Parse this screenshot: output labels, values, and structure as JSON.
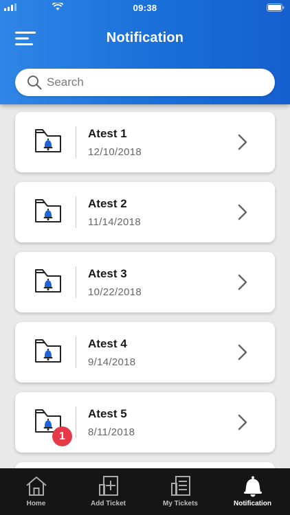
{
  "status_bar": {
    "time": "09:38"
  },
  "header": {
    "title": "Notification"
  },
  "search": {
    "placeholder": "Search",
    "value": ""
  },
  "notifications": [
    {
      "title": "Atest 1",
      "date": "12/10/2018",
      "icon": "folder-bell-icon"
    },
    {
      "title": "Atest 2",
      "date": "11/14/2018",
      "icon": "folder-bell-icon"
    },
    {
      "title": "Atest 3",
      "date": "10/22/2018",
      "icon": "folder-bell-icon"
    },
    {
      "title": "Atest 4",
      "date": "9/14/2018",
      "icon": "folder-bell-icon"
    },
    {
      "title": "Atest 5",
      "date": "8/11/2018",
      "icon": "folder-bell-icon",
      "badge": "1"
    }
  ],
  "tabs": [
    {
      "label": "Home",
      "icon": "home-icon"
    },
    {
      "label": "Add Ticket",
      "icon": "add-ticket-icon"
    },
    {
      "label": "My Tickets",
      "icon": "tickets-icon"
    },
    {
      "label": "Notification",
      "icon": "bell-icon",
      "active": true
    }
  ],
  "colors": {
    "header": "#1a6fd8",
    "badge": "#e53b48",
    "tabbar": "#151515",
    "bell": "#1f64d8"
  }
}
